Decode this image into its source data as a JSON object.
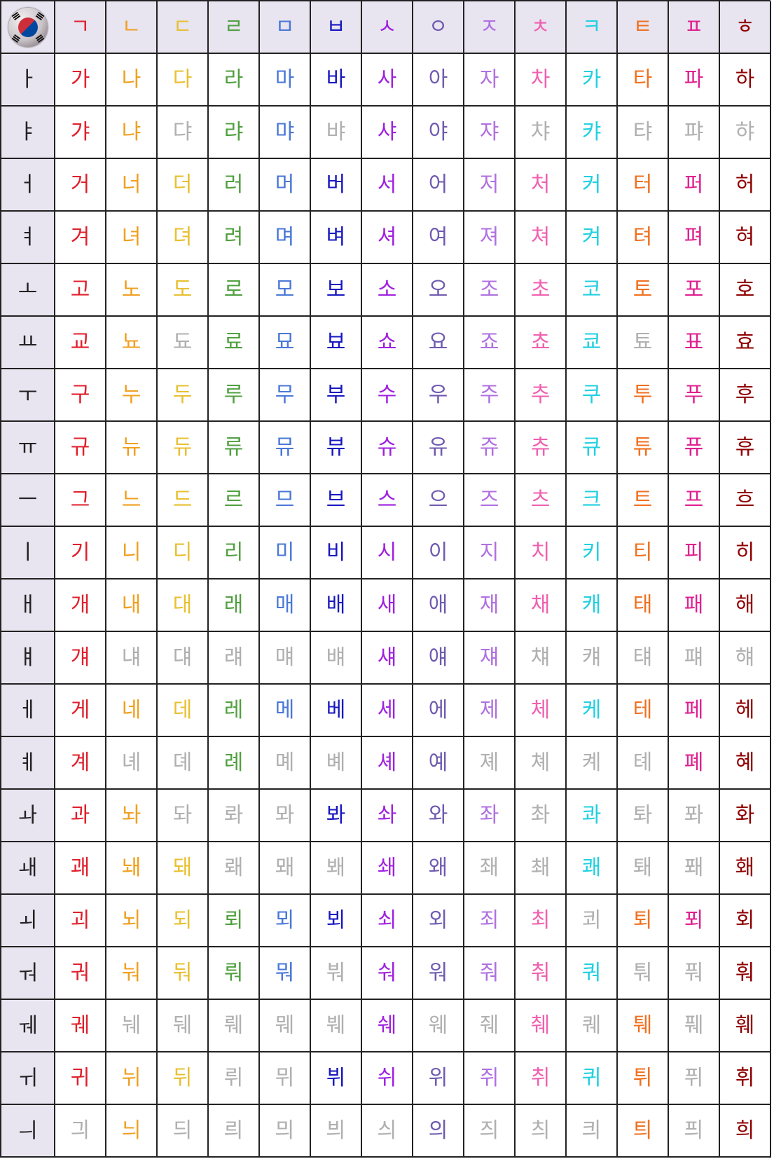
{
  "colors": {
    "disabled": "#b0b0b0",
    "vowel": "#222222",
    "header_bg": "#e8e4f0",
    "consonants": [
      "#e0202c",
      "#f0a020",
      "#e8c030",
      "#50a040",
      "#4a78d8",
      "#1818c0",
      "#a020e0",
      "#705ab0",
      "#b070e0",
      "#f060b0",
      "#20d0e0",
      "#f07020",
      "#e02090",
      "#900000"
    ]
  },
  "flag_icon": "south-korea-flag-icon",
  "consonants": [
    "ㄱ",
    "ㄴ",
    "ㄷ",
    "ㄹ",
    "ㅁ",
    "ㅂ",
    "ㅅ",
    "ㅇ",
    "ㅈ",
    "ㅊ",
    "ㅋ",
    "ㅌ",
    "ㅍ",
    "ㅎ"
  ],
  "rows": [
    {
      "vowel": "ㅏ",
      "syllables": [
        "가",
        "나",
        "다",
        "라",
        "마",
        "바",
        "사",
        "아",
        "자",
        "차",
        "카",
        "타",
        "파",
        "하"
      ],
      "disabled": []
    },
    {
      "vowel": "ㅑ",
      "syllables": [
        "갸",
        "냐",
        "댜",
        "랴",
        "먀",
        "뱌",
        "샤",
        "야",
        "쟈",
        "챠",
        "캬",
        "탸",
        "퍄",
        "햐"
      ],
      "disabled": [
        2,
        5,
        9,
        11,
        12,
        13
      ]
    },
    {
      "vowel": "ㅓ",
      "syllables": [
        "거",
        "너",
        "더",
        "러",
        "머",
        "버",
        "서",
        "어",
        "저",
        "처",
        "커",
        "터",
        "퍼",
        "허"
      ],
      "disabled": []
    },
    {
      "vowel": "ㅕ",
      "syllables": [
        "겨",
        "녀",
        "뎌",
        "려",
        "며",
        "벼",
        "셔",
        "여",
        "져",
        "쳐",
        "켜",
        "텨",
        "펴",
        "혀"
      ],
      "disabled": []
    },
    {
      "vowel": "ㅗ",
      "syllables": [
        "고",
        "노",
        "도",
        "로",
        "모",
        "보",
        "소",
        "오",
        "조",
        "초",
        "코",
        "토",
        "포",
        "호"
      ],
      "disabled": []
    },
    {
      "vowel": "ㅛ",
      "syllables": [
        "교",
        "뇨",
        "됴",
        "료",
        "묘",
        "뵤",
        "쇼",
        "요",
        "죠",
        "쵸",
        "쿄",
        "툐",
        "표",
        "효"
      ],
      "disabled": [
        2,
        11
      ]
    },
    {
      "vowel": "ㅜ",
      "syllables": [
        "구",
        "누",
        "두",
        "루",
        "무",
        "부",
        "수",
        "우",
        "주",
        "추",
        "쿠",
        "투",
        "푸",
        "후"
      ],
      "disabled": []
    },
    {
      "vowel": "ㅠ",
      "syllables": [
        "규",
        "뉴",
        "듀",
        "류",
        "뮤",
        "뷰",
        "슈",
        "유",
        "쥬",
        "츄",
        "큐",
        "튜",
        "퓨",
        "휴"
      ],
      "disabled": []
    },
    {
      "vowel": "ㅡ",
      "syllables": [
        "그",
        "느",
        "드",
        "르",
        "므",
        "브",
        "스",
        "으",
        "즈",
        "츠",
        "크",
        "트",
        "프",
        "흐"
      ],
      "disabled": []
    },
    {
      "vowel": "ㅣ",
      "syllables": [
        "기",
        "니",
        "디",
        "리",
        "미",
        "비",
        "시",
        "이",
        "지",
        "치",
        "키",
        "티",
        "피",
        "히"
      ],
      "disabled": []
    },
    {
      "vowel": "ㅐ",
      "syllables": [
        "개",
        "내",
        "대",
        "래",
        "매",
        "배",
        "새",
        "애",
        "재",
        "채",
        "캐",
        "태",
        "패",
        "해"
      ],
      "disabled": []
    },
    {
      "vowel": "ㅒ",
      "syllables": [
        "걔",
        "냬",
        "댸",
        "럐",
        "먜",
        "뱨",
        "섀",
        "얘",
        "쟤",
        "챼",
        "컈",
        "턔",
        "퍠",
        "햬"
      ],
      "disabled": [
        1,
        2,
        3,
        4,
        5,
        9,
        10,
        11,
        12,
        13
      ]
    },
    {
      "vowel": "ㅔ",
      "syllables": [
        "게",
        "네",
        "데",
        "레",
        "메",
        "베",
        "세",
        "에",
        "제",
        "체",
        "케",
        "테",
        "페",
        "헤"
      ],
      "disabled": []
    },
    {
      "vowel": "ㅖ",
      "syllables": [
        "계",
        "녜",
        "뎨",
        "례",
        "몌",
        "볘",
        "셰",
        "예",
        "졔",
        "쳬",
        "켸",
        "톄",
        "폐",
        "혜"
      ],
      "disabled": [
        1,
        2,
        4,
        5,
        8,
        9,
        10,
        11
      ]
    },
    {
      "vowel": "ㅘ",
      "syllables": [
        "과",
        "놔",
        "돠",
        "롸",
        "뫄",
        "봐",
        "솨",
        "와",
        "좌",
        "촤",
        "콰",
        "톼",
        "퐈",
        "화"
      ],
      "disabled": [
        2,
        3,
        4,
        9,
        11,
        12
      ]
    },
    {
      "vowel": "ㅙ",
      "syllables": [
        "괘",
        "놰",
        "돼",
        "뢔",
        "뫠",
        "봬",
        "쇄",
        "왜",
        "좨",
        "쵀",
        "쾌",
        "퇘",
        "퐤",
        "홰"
      ],
      "disabled": [
        3,
        4,
        5,
        8,
        9,
        11,
        12
      ]
    },
    {
      "vowel": "ㅚ",
      "syllables": [
        "괴",
        "뇌",
        "되",
        "뢰",
        "뫼",
        "뵈",
        "쇠",
        "외",
        "죄",
        "최",
        "쾨",
        "퇴",
        "푀",
        "회"
      ],
      "disabled": [
        10
      ]
    },
    {
      "vowel": "ㅝ",
      "syllables": [
        "궈",
        "눠",
        "둬",
        "뤄",
        "뭐",
        "붜",
        "숴",
        "워",
        "줘",
        "춰",
        "쿼",
        "퉈",
        "풔",
        "훠"
      ],
      "disabled": [
        5,
        11,
        12
      ]
    },
    {
      "vowel": "ㅞ",
      "syllables": [
        "궤",
        "눼",
        "뒈",
        "뤠",
        "뭬",
        "붸",
        "쉐",
        "웨",
        "줴",
        "췌",
        "퀘",
        "퉤",
        "풰",
        "훼"
      ],
      "disabled": [
        1,
        2,
        3,
        4,
        5,
        7,
        8,
        10,
        12
      ]
    },
    {
      "vowel": "ㅟ",
      "syllables": [
        "귀",
        "뉘",
        "뒤",
        "뤼",
        "뮈",
        "뷔",
        "쉬",
        "위",
        "쥐",
        "취",
        "퀴",
        "튀",
        "퓌",
        "휘"
      ],
      "disabled": [
        3,
        4,
        12
      ]
    },
    {
      "vowel": "ㅢ",
      "syllables": [
        "긔",
        "늬",
        "듸",
        "릐",
        "믜",
        "븨",
        "싀",
        "의",
        "즤",
        "츼",
        "킈",
        "틔",
        "픠",
        "희"
      ],
      "disabled": [
        0,
        2,
        3,
        4,
        5,
        6,
        8,
        9,
        10,
        12
      ]
    }
  ]
}
